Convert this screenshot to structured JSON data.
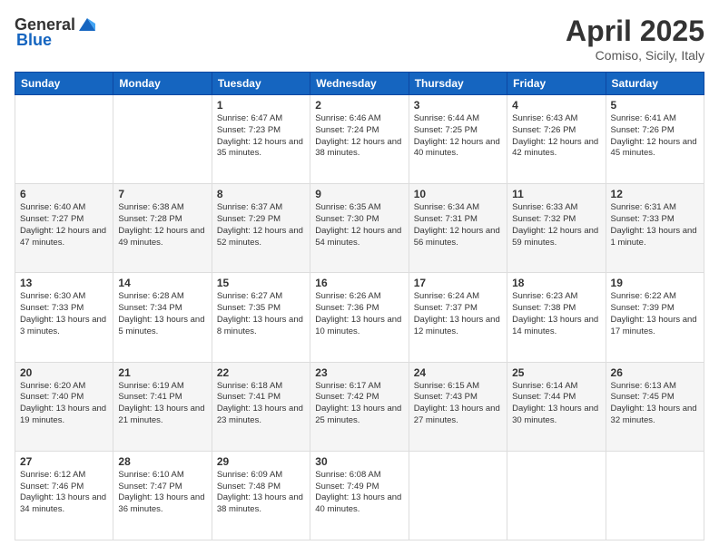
{
  "header": {
    "logo_general": "General",
    "logo_blue": "Blue",
    "title": "April 2025",
    "subtitle": "Comiso, Sicily, Italy"
  },
  "days_of_week": [
    "Sunday",
    "Monday",
    "Tuesday",
    "Wednesday",
    "Thursday",
    "Friday",
    "Saturday"
  ],
  "weeks": [
    [
      {
        "day": "",
        "sunrise": "",
        "sunset": "",
        "daylight": ""
      },
      {
        "day": "",
        "sunrise": "",
        "sunset": "",
        "daylight": ""
      },
      {
        "day": "1",
        "sunrise": "Sunrise: 6:47 AM",
        "sunset": "Sunset: 7:23 PM",
        "daylight": "Daylight: 12 hours and 35 minutes."
      },
      {
        "day": "2",
        "sunrise": "Sunrise: 6:46 AM",
        "sunset": "Sunset: 7:24 PM",
        "daylight": "Daylight: 12 hours and 38 minutes."
      },
      {
        "day": "3",
        "sunrise": "Sunrise: 6:44 AM",
        "sunset": "Sunset: 7:25 PM",
        "daylight": "Daylight: 12 hours and 40 minutes."
      },
      {
        "day": "4",
        "sunrise": "Sunrise: 6:43 AM",
        "sunset": "Sunset: 7:26 PM",
        "daylight": "Daylight: 12 hours and 42 minutes."
      },
      {
        "day": "5",
        "sunrise": "Sunrise: 6:41 AM",
        "sunset": "Sunset: 7:26 PM",
        "daylight": "Daylight: 12 hours and 45 minutes."
      }
    ],
    [
      {
        "day": "6",
        "sunrise": "Sunrise: 6:40 AM",
        "sunset": "Sunset: 7:27 PM",
        "daylight": "Daylight: 12 hours and 47 minutes."
      },
      {
        "day": "7",
        "sunrise": "Sunrise: 6:38 AM",
        "sunset": "Sunset: 7:28 PM",
        "daylight": "Daylight: 12 hours and 49 minutes."
      },
      {
        "day": "8",
        "sunrise": "Sunrise: 6:37 AM",
        "sunset": "Sunset: 7:29 PM",
        "daylight": "Daylight: 12 hours and 52 minutes."
      },
      {
        "day": "9",
        "sunrise": "Sunrise: 6:35 AM",
        "sunset": "Sunset: 7:30 PM",
        "daylight": "Daylight: 12 hours and 54 minutes."
      },
      {
        "day": "10",
        "sunrise": "Sunrise: 6:34 AM",
        "sunset": "Sunset: 7:31 PM",
        "daylight": "Daylight: 12 hours and 56 minutes."
      },
      {
        "day": "11",
        "sunrise": "Sunrise: 6:33 AM",
        "sunset": "Sunset: 7:32 PM",
        "daylight": "Daylight: 12 hours and 59 minutes."
      },
      {
        "day": "12",
        "sunrise": "Sunrise: 6:31 AM",
        "sunset": "Sunset: 7:33 PM",
        "daylight": "Daylight: 13 hours and 1 minute."
      }
    ],
    [
      {
        "day": "13",
        "sunrise": "Sunrise: 6:30 AM",
        "sunset": "Sunset: 7:33 PM",
        "daylight": "Daylight: 13 hours and 3 minutes."
      },
      {
        "day": "14",
        "sunrise": "Sunrise: 6:28 AM",
        "sunset": "Sunset: 7:34 PM",
        "daylight": "Daylight: 13 hours and 5 minutes."
      },
      {
        "day": "15",
        "sunrise": "Sunrise: 6:27 AM",
        "sunset": "Sunset: 7:35 PM",
        "daylight": "Daylight: 13 hours and 8 minutes."
      },
      {
        "day": "16",
        "sunrise": "Sunrise: 6:26 AM",
        "sunset": "Sunset: 7:36 PM",
        "daylight": "Daylight: 13 hours and 10 minutes."
      },
      {
        "day": "17",
        "sunrise": "Sunrise: 6:24 AM",
        "sunset": "Sunset: 7:37 PM",
        "daylight": "Daylight: 13 hours and 12 minutes."
      },
      {
        "day": "18",
        "sunrise": "Sunrise: 6:23 AM",
        "sunset": "Sunset: 7:38 PM",
        "daylight": "Daylight: 13 hours and 14 minutes."
      },
      {
        "day": "19",
        "sunrise": "Sunrise: 6:22 AM",
        "sunset": "Sunset: 7:39 PM",
        "daylight": "Daylight: 13 hours and 17 minutes."
      }
    ],
    [
      {
        "day": "20",
        "sunrise": "Sunrise: 6:20 AM",
        "sunset": "Sunset: 7:40 PM",
        "daylight": "Daylight: 13 hours and 19 minutes."
      },
      {
        "day": "21",
        "sunrise": "Sunrise: 6:19 AM",
        "sunset": "Sunset: 7:41 PM",
        "daylight": "Daylight: 13 hours and 21 minutes."
      },
      {
        "day": "22",
        "sunrise": "Sunrise: 6:18 AM",
        "sunset": "Sunset: 7:41 PM",
        "daylight": "Daylight: 13 hours and 23 minutes."
      },
      {
        "day": "23",
        "sunrise": "Sunrise: 6:17 AM",
        "sunset": "Sunset: 7:42 PM",
        "daylight": "Daylight: 13 hours and 25 minutes."
      },
      {
        "day": "24",
        "sunrise": "Sunrise: 6:15 AM",
        "sunset": "Sunset: 7:43 PM",
        "daylight": "Daylight: 13 hours and 27 minutes."
      },
      {
        "day": "25",
        "sunrise": "Sunrise: 6:14 AM",
        "sunset": "Sunset: 7:44 PM",
        "daylight": "Daylight: 13 hours and 30 minutes."
      },
      {
        "day": "26",
        "sunrise": "Sunrise: 6:13 AM",
        "sunset": "Sunset: 7:45 PM",
        "daylight": "Daylight: 13 hours and 32 minutes."
      }
    ],
    [
      {
        "day": "27",
        "sunrise": "Sunrise: 6:12 AM",
        "sunset": "Sunset: 7:46 PM",
        "daylight": "Daylight: 13 hours and 34 minutes."
      },
      {
        "day": "28",
        "sunrise": "Sunrise: 6:10 AM",
        "sunset": "Sunset: 7:47 PM",
        "daylight": "Daylight: 13 hours and 36 minutes."
      },
      {
        "day": "29",
        "sunrise": "Sunrise: 6:09 AM",
        "sunset": "Sunset: 7:48 PM",
        "daylight": "Daylight: 13 hours and 38 minutes."
      },
      {
        "day": "30",
        "sunrise": "Sunrise: 6:08 AM",
        "sunset": "Sunset: 7:49 PM",
        "daylight": "Daylight: 13 hours and 40 minutes."
      },
      {
        "day": "",
        "sunrise": "",
        "sunset": "",
        "daylight": ""
      },
      {
        "day": "",
        "sunrise": "",
        "sunset": "",
        "daylight": ""
      },
      {
        "day": "",
        "sunrise": "",
        "sunset": "",
        "daylight": ""
      }
    ]
  ]
}
